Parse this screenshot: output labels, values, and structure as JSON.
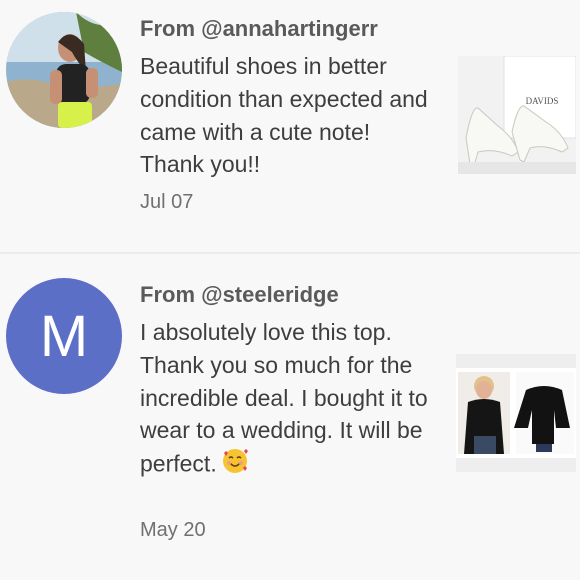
{
  "reviews": [
    {
      "from": "From @annahartingerr",
      "text": "Beautiful shoes in better condition than expected and came with a cute note! Thank you!!",
      "date": "Jul 07",
      "product_box_text": "DAVIDS"
    },
    {
      "from": "From @steeleridge",
      "text": "I absolutely love this top. Thank you so much for the incredible deal. I bought it to wear to a wedding. It will be perfect.",
      "date": "May 20",
      "avatar_letter": "M",
      "avatar_color": "#5c6fc7"
    }
  ],
  "emoji": "smiling-face-with-hearts"
}
